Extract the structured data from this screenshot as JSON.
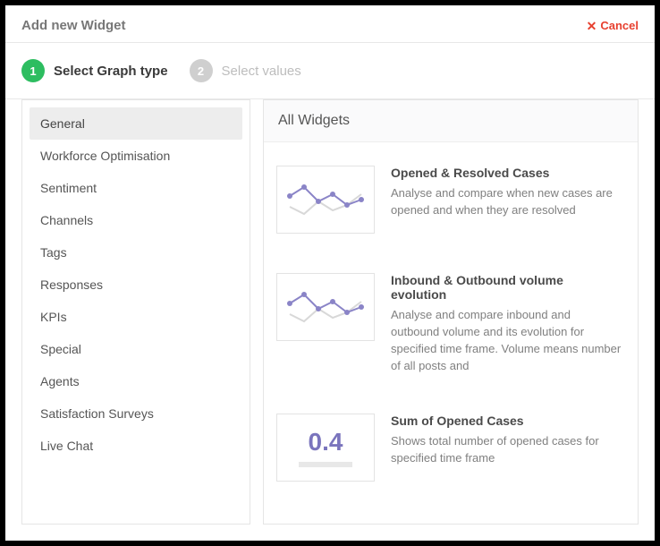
{
  "header": {
    "title": "Add new Widget",
    "cancel_label": "Cancel"
  },
  "steps": [
    {
      "num": "1",
      "label": "Select Graph type",
      "active": true
    },
    {
      "num": "2",
      "label": "Select values",
      "active": false
    }
  ],
  "sidebar": {
    "items": [
      {
        "label": "General",
        "selected": true
      },
      {
        "label": "Workforce Optimisation",
        "selected": false
      },
      {
        "label": "Sentiment",
        "selected": false
      },
      {
        "label": "Channels",
        "selected": false
      },
      {
        "label": "Tags",
        "selected": false
      },
      {
        "label": "Responses",
        "selected": false
      },
      {
        "label": "KPIs",
        "selected": false
      },
      {
        "label": "Special",
        "selected": false
      },
      {
        "label": "Agents",
        "selected": false
      },
      {
        "label": "Satisfaction Surveys",
        "selected": false
      },
      {
        "label": "Live Chat",
        "selected": false
      }
    ]
  },
  "main": {
    "header": "All Widgets",
    "widgets": [
      {
        "title": "Opened & Resolved Cases",
        "desc": "Analyse and compare when new cases are opened and when they are resolved",
        "thumb": "line"
      },
      {
        "title": "Inbound & Outbound volume evolution",
        "desc": "Analyse and compare inbound and outbound volume and its evolution for specified time frame. Volume means number of all posts and",
        "thumb": "line"
      },
      {
        "title": "Sum of Opened Cases",
        "desc": "Shows total number of opened cases for specified time frame",
        "thumb": "kpi",
        "kpi_value": "0.4"
      }
    ]
  },
  "colors": {
    "accent_green": "#2dbd60",
    "accent_red": "#e7402f",
    "accent_purple": "#7a74bd"
  }
}
